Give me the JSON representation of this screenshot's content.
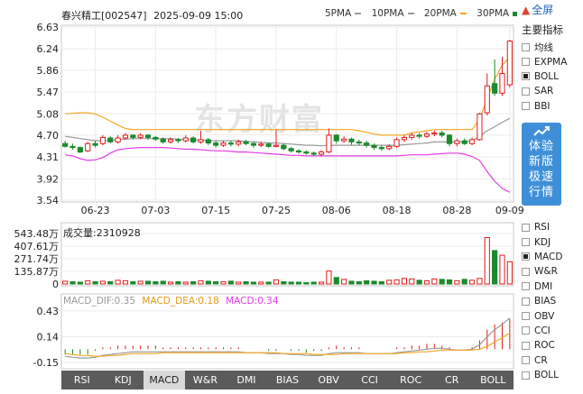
{
  "header": {
    "stock_name": "春兴精工",
    "stock_code": "[002547]",
    "datetime": "2025-09-09 15:00"
  },
  "ma_legend": [
    {
      "label": "5PMA",
      "color": "#999999"
    },
    {
      "label": "10PMA",
      "color": "#999999"
    },
    {
      "label": "20PMA",
      "color": "#f5a623"
    },
    {
      "label": "30PMA",
      "color": "#e43be8"
    }
  ],
  "ma_legend_end_color": "#1a8a2a",
  "fullscreen_label": "全屏",
  "indicator_panel_title": "主要指标",
  "main_indicators": [
    {
      "label": "均线",
      "checked": false
    },
    {
      "label": "EXPMA",
      "checked": false
    },
    {
      "label": "BOLL",
      "checked": true
    },
    {
      "label": "SAR",
      "checked": false
    },
    {
      "label": "BBI",
      "checked": false
    }
  ],
  "promo_text": "体验新版极速行情",
  "watermark": "东方财富",
  "sub_indicators": [
    {
      "label": "RSI",
      "checked": false
    },
    {
      "label": "KDJ",
      "checked": false
    },
    {
      "label": "MACD",
      "checked": true
    },
    {
      "label": "W&R",
      "checked": false
    },
    {
      "label": "DMI",
      "checked": false
    },
    {
      "label": "BIAS",
      "checked": false
    },
    {
      "label": "OBV",
      "checked": false
    },
    {
      "label": "CCI",
      "checked": false
    },
    {
      "label": "ROC",
      "checked": false
    },
    {
      "label": "CR",
      "checked": false
    },
    {
      "label": "BOLL",
      "checked": false
    }
  ],
  "tabs": [
    {
      "label": "RSI",
      "active": false
    },
    {
      "label": "KDJ",
      "active": false
    },
    {
      "label": "MACD",
      "active": true
    },
    {
      "label": "W&R",
      "active": false
    },
    {
      "label": "DMI",
      "active": false
    },
    {
      "label": "BIAS",
      "active": false
    },
    {
      "label": "OBV",
      "active": false
    },
    {
      "label": "CCI",
      "active": false
    },
    {
      "label": "ROC",
      "active": false
    },
    {
      "label": "CR",
      "active": false
    },
    {
      "label": "BOLL",
      "active": false
    }
  ],
  "volume_label": "成交量:2310928",
  "macd_labels": {
    "dif": "MACD_DIF:0.35",
    "dea": "MACD_DEA:0.18",
    "macd": "MACD:0.34"
  },
  "colors": {
    "up": "#e01b1b",
    "down": "#1a8a2a",
    "upper_band": "#f5a623",
    "lower_band": "#e43be8",
    "mid_band": "#999999",
    "dif_line": "#999999",
    "dea_line": "#f5a623",
    "macd_text": "#e43be8"
  },
  "chart_data": [
    {
      "type": "candlestick",
      "name": "price",
      "y_ticks": [
        "6.63",
        "6.24",
        "5.86",
        "5.47",
        "5.08",
        "4.70",
        "4.31",
        "3.92",
        "3.54"
      ],
      "ylim": [
        3.54,
        6.63
      ],
      "x_ticks": [
        {
          "label": "06-23",
          "index": 4
        },
        {
          "label": "07-03",
          "index": 12
        },
        {
          "label": "07-15",
          "index": 20
        },
        {
          "label": "07-25",
          "index": 28
        },
        {
          "label": "08-06",
          "index": 36
        },
        {
          "label": "08-18",
          "index": 44
        },
        {
          "label": "08-28",
          "index": 52
        },
        {
          "label": "09-09",
          "index": 59
        }
      ],
      "candles": [
        [
          4.55,
          4.5,
          4.6,
          4.48
        ],
        [
          4.5,
          4.48,
          4.55,
          4.44
        ],
        [
          4.48,
          4.4,
          4.5,
          4.38
        ],
        [
          4.42,
          4.55,
          4.58,
          4.4
        ],
        [
          4.55,
          4.52,
          4.6,
          4.48
        ],
        [
          4.55,
          4.66,
          4.7,
          4.52
        ],
        [
          4.65,
          4.58,
          4.68,
          4.55
        ],
        [
          4.58,
          4.65,
          4.7,
          4.55
        ],
        [
          4.65,
          4.7,
          4.74,
          4.62
        ],
        [
          4.7,
          4.66,
          4.72,
          4.62
        ],
        [
          4.66,
          4.7,
          4.74,
          4.63
        ],
        [
          4.7,
          4.66,
          4.72,
          4.62
        ],
        [
          4.66,
          4.63,
          4.68,
          4.6
        ],
        [
          4.63,
          4.58,
          4.66,
          4.55
        ],
        [
          4.58,
          4.62,
          4.66,
          4.55
        ],
        [
          4.62,
          4.6,
          4.65,
          4.56
        ],
        [
          4.6,
          4.65,
          4.7,
          4.57
        ],
        [
          4.65,
          4.58,
          4.68,
          4.55
        ],
        [
          4.58,
          4.62,
          4.78,
          4.55
        ],
        [
          4.62,
          4.56,
          4.65,
          4.52
        ],
        [
          4.56,
          4.52,
          4.6,
          4.48
        ],
        [
          4.52,
          4.56,
          4.6,
          4.49
        ],
        [
          4.56,
          4.54,
          4.6,
          4.5
        ],
        [
          4.54,
          4.58,
          4.62,
          4.5
        ],
        [
          4.58,
          4.55,
          4.62,
          4.52
        ],
        [
          4.55,
          4.52,
          4.58,
          4.48
        ],
        [
          4.52,
          4.54,
          4.58,
          4.49
        ],
        [
          4.54,
          4.5,
          4.57,
          4.47
        ],
        [
          4.5,
          4.52,
          4.8,
          4.48
        ],
        [
          4.52,
          4.46,
          4.55,
          4.43
        ],
        [
          4.46,
          4.42,
          4.49,
          4.39
        ],
        [
          4.42,
          4.4,
          4.45,
          4.37
        ],
        [
          4.4,
          4.38,
          4.43,
          4.35
        ],
        [
          4.38,
          4.36,
          4.41,
          4.33
        ],
        [
          4.36,
          4.4,
          4.43,
          4.33
        ],
        [
          4.4,
          4.7,
          4.82,
          4.38
        ],
        [
          4.7,
          4.6,
          4.72,
          4.55
        ],
        [
          4.6,
          4.63,
          4.68,
          4.56
        ],
        [
          4.63,
          4.58,
          4.66,
          4.53
        ],
        [
          4.58,
          4.56,
          4.62,
          4.52
        ],
        [
          4.56,
          4.52,
          4.6,
          4.48
        ],
        [
          4.52,
          4.48,
          4.55,
          4.44
        ],
        [
          4.48,
          4.46,
          4.52,
          4.42
        ],
        [
          4.46,
          4.5,
          4.54,
          4.43
        ],
        [
          4.5,
          4.62,
          4.66,
          4.47
        ],
        [
          4.62,
          4.66,
          4.7,
          4.58
        ],
        [
          4.66,
          4.7,
          4.74,
          4.62
        ],
        [
          4.7,
          4.68,
          4.74,
          4.64
        ],
        [
          4.68,
          4.72,
          4.76,
          4.65
        ],
        [
          4.72,
          4.74,
          4.78,
          4.68
        ],
        [
          4.74,
          4.7,
          4.78,
          4.66
        ],
        [
          4.7,
          4.55,
          4.72,
          4.5
        ],
        [
          4.55,
          4.6,
          4.64,
          4.5
        ],
        [
          4.6,
          4.55,
          4.64,
          4.52
        ],
        [
          4.55,
          4.62,
          4.66,
          4.52
        ],
        [
          4.62,
          5.08,
          5.1,
          4.6
        ],
        [
          5.1,
          5.58,
          5.8,
          5.05
        ],
        [
          5.62,
          5.45,
          6.05,
          5.4
        ],
        [
          5.45,
          5.8,
          6.1,
          5.4
        ],
        [
          5.6,
          6.38,
          6.4,
          5.55
        ]
      ],
      "boll_upper": [
        5.08,
        5.09,
        5.1,
        5.1,
        5.08,
        5.02,
        4.95,
        4.88,
        4.82,
        4.8,
        4.8,
        4.8,
        4.8,
        4.8,
        4.8,
        4.8,
        4.8,
        4.8,
        4.8,
        4.8,
        4.8,
        4.8,
        4.8,
        4.8,
        4.8,
        4.8,
        4.8,
        4.8,
        4.8,
        4.8,
        4.8,
        4.8,
        4.8,
        4.8,
        4.8,
        4.8,
        4.8,
        4.8,
        4.8,
        4.78,
        4.75,
        4.72,
        4.7,
        4.7,
        4.7,
        4.7,
        4.74,
        4.76,
        4.78,
        4.8,
        4.8,
        4.8,
        4.8,
        4.8,
        4.8,
        4.98,
        5.35,
        5.7,
        5.95,
        6.1
      ],
      "boll_mid": [
        4.68,
        4.66,
        4.64,
        4.62,
        4.6,
        4.6,
        4.61,
        4.62,
        4.63,
        4.64,
        4.64,
        4.64,
        4.64,
        4.64,
        4.64,
        4.63,
        4.62,
        4.62,
        4.61,
        4.6,
        4.6,
        4.6,
        4.6,
        4.6,
        4.59,
        4.58,
        4.57,
        4.56,
        4.56,
        4.55,
        4.54,
        4.53,
        4.52,
        4.52,
        4.51,
        4.52,
        4.52,
        4.52,
        4.52,
        4.52,
        4.52,
        4.52,
        4.52,
        4.52,
        4.52,
        4.53,
        4.54,
        4.55,
        4.56,
        4.58,
        4.58,
        4.58,
        4.58,
        4.58,
        4.6,
        4.68,
        4.78,
        4.85,
        4.93,
        5.0
      ],
      "boll_lower": [
        4.35,
        4.33,
        4.28,
        4.25,
        4.26,
        4.3,
        4.38,
        4.44,
        4.46,
        4.47,
        4.48,
        4.48,
        4.48,
        4.48,
        4.47,
        4.46,
        4.45,
        4.45,
        4.44,
        4.43,
        4.42,
        4.42,
        4.41,
        4.4,
        4.4,
        4.39,
        4.38,
        4.37,
        4.36,
        4.35,
        4.34,
        4.34,
        4.33,
        4.33,
        4.33,
        4.33,
        4.33,
        4.33,
        4.33,
        4.33,
        4.33,
        4.33,
        4.33,
        4.33,
        4.33,
        4.34,
        4.35,
        4.35,
        4.35,
        4.36,
        4.37,
        4.38,
        4.38,
        4.36,
        4.32,
        4.25,
        4.05,
        3.88,
        3.75,
        3.68
      ]
    },
    {
      "type": "bar",
      "name": "volume",
      "y_ticks": [
        "543.48万",
        "407.61万",
        "271.74万",
        "135.87万",
        "0"
      ],
      "ylim": [
        0,
        543.48
      ],
      "values": [
        30,
        25,
        20,
        35,
        25,
        30,
        25,
        40,
        35,
        25,
        30,
        30,
        25,
        30,
        20,
        25,
        20,
        25,
        35,
        30,
        25,
        25,
        30,
        20,
        25,
        20,
        20,
        20,
        45,
        25,
        20,
        20,
        15,
        20,
        20,
        140,
        70,
        50,
        30,
        25,
        35,
        30,
        25,
        40,
        45,
        60,
        55,
        40,
        35,
        55,
        50,
        45,
        35,
        50,
        40,
        60,
        500,
        360,
        310,
        240
      ],
      "up": [
        true,
        false,
        false,
        true,
        false,
        true,
        false,
        true,
        true,
        false,
        true,
        false,
        false,
        false,
        true,
        false,
        true,
        false,
        true,
        false,
        false,
        true,
        false,
        true,
        false,
        false,
        true,
        false,
        true,
        false,
        false,
        false,
        false,
        false,
        true,
        true,
        false,
        true,
        false,
        false,
        false,
        false,
        false,
        true,
        true,
        true,
        true,
        false,
        true,
        true,
        false,
        false,
        true,
        false,
        true,
        true,
        true,
        false,
        true,
        true
      ]
    },
    {
      "type": "macd",
      "name": "macd",
      "y_ticks": [
        "0.43",
        "0.14",
        "-0.15"
      ],
      "ylim": [
        -0.2,
        0.5
      ],
      "dif": [
        -0.08,
        -0.09,
        -0.1,
        -0.1,
        -0.09,
        -0.07,
        -0.06,
        -0.05,
        -0.04,
        -0.03,
        -0.03,
        -0.03,
        -0.03,
        -0.03,
        -0.03,
        -0.03,
        -0.03,
        -0.03,
        -0.03,
        -0.03,
        -0.03,
        -0.03,
        -0.03,
        -0.03,
        -0.04,
        -0.04,
        -0.04,
        -0.05,
        -0.05,
        -0.05,
        -0.06,
        -0.06,
        -0.07,
        -0.07,
        -0.07,
        -0.05,
        -0.04,
        -0.04,
        -0.04,
        -0.04,
        -0.05,
        -0.05,
        -0.05,
        -0.05,
        -0.04,
        -0.03,
        -0.02,
        -0.01,
        0.0,
        0.01,
        0.01,
        0.0,
        -0.01,
        -0.01,
        0.0,
        0.05,
        0.14,
        0.22,
        0.28,
        0.35
      ],
      "dea": [
        -0.05,
        -0.06,
        -0.07,
        -0.07,
        -0.08,
        -0.08,
        -0.07,
        -0.07,
        -0.06,
        -0.05,
        -0.05,
        -0.05,
        -0.05,
        -0.04,
        -0.04,
        -0.04,
        -0.04,
        -0.04,
        -0.04,
        -0.04,
        -0.04,
        -0.04,
        -0.04,
        -0.04,
        -0.04,
        -0.04,
        -0.04,
        -0.04,
        -0.04,
        -0.05,
        -0.05,
        -0.05,
        -0.05,
        -0.06,
        -0.06,
        -0.06,
        -0.06,
        -0.05,
        -0.05,
        -0.05,
        -0.05,
        -0.05,
        -0.05,
        -0.05,
        -0.05,
        -0.04,
        -0.04,
        -0.03,
        -0.03,
        -0.02,
        -0.01,
        -0.01,
        -0.01,
        -0.01,
        -0.01,
        0.0,
        0.03,
        0.08,
        0.13,
        0.18
      ],
      "hist": [
        -0.06,
        -0.06,
        -0.06,
        -0.06,
        -0.02,
        0.02,
        0.02,
        0.04,
        0.04,
        0.04,
        0.04,
        0.04,
        0.04,
        0.02,
        0.02,
        0.02,
        0.02,
        0.02,
        0.02,
        0.02,
        0.02,
        0.02,
        0.02,
        0.02,
        0.0,
        0.0,
        0.0,
        -0.02,
        -0.02,
        0.0,
        -0.02,
        -0.02,
        -0.04,
        -0.02,
        -0.02,
        0.02,
        0.04,
        0.02,
        0.02,
        0.02,
        0.0,
        0.0,
        0.0,
        0.0,
        0.02,
        0.02,
        0.04,
        0.04,
        0.06,
        0.06,
        0.04,
        0.02,
        0.0,
        0.0,
        0.02,
        0.1,
        0.22,
        0.28,
        0.3,
        0.34
      ]
    }
  ]
}
